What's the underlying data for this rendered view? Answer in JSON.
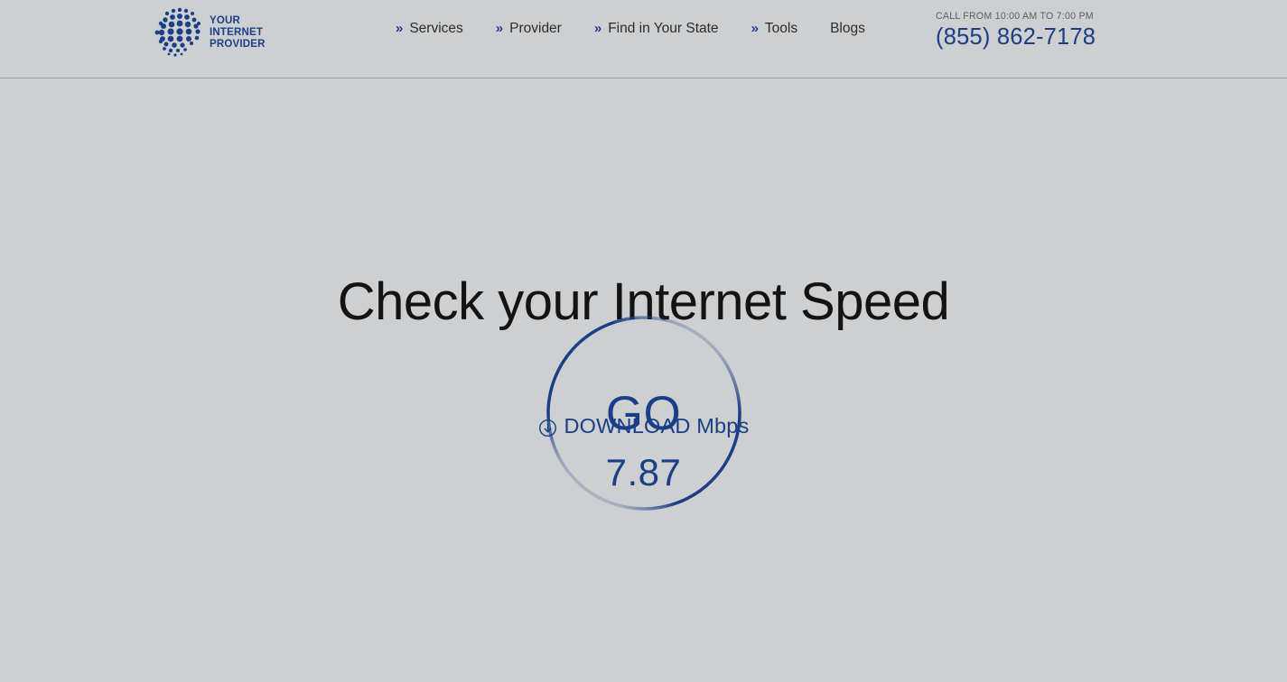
{
  "header": {
    "logo": {
      "icon": "globe-dots-logo",
      "line1": "YOUR",
      "line2": "INTERNET",
      "line3": "PROVIDER"
    },
    "nav": [
      {
        "label": "Services",
        "chevron": "»",
        "has_chevron": true
      },
      {
        "label": "Provider",
        "chevron": "»",
        "has_chevron": true
      },
      {
        "label": "Find in Your State",
        "chevron": "»",
        "has_chevron": true
      },
      {
        "label": "Tools",
        "chevron": "»",
        "has_chevron": true
      },
      {
        "label": "Blogs",
        "chevron": "",
        "has_chevron": false
      }
    ],
    "call": {
      "hours": "CALL FROM 10:00 AM TO 7:00 PM",
      "phone": "(855) 862‑7178"
    }
  },
  "main": {
    "title": "Check your Internet Speed",
    "go_button": {
      "label": "GO"
    },
    "result": {
      "icon": "download-circle-arrow-icon",
      "metric_label": "DOWNLOAD Mbps",
      "value": "7.87"
    }
  },
  "colors": {
    "page_background": "#cdcfd1",
    "brand_blue": "#1b3f87",
    "heading_text": "#131313",
    "nav_text": "#2b2b2b",
    "muted_text": "#5b5f66",
    "header_border": "#9c9fa2"
  }
}
